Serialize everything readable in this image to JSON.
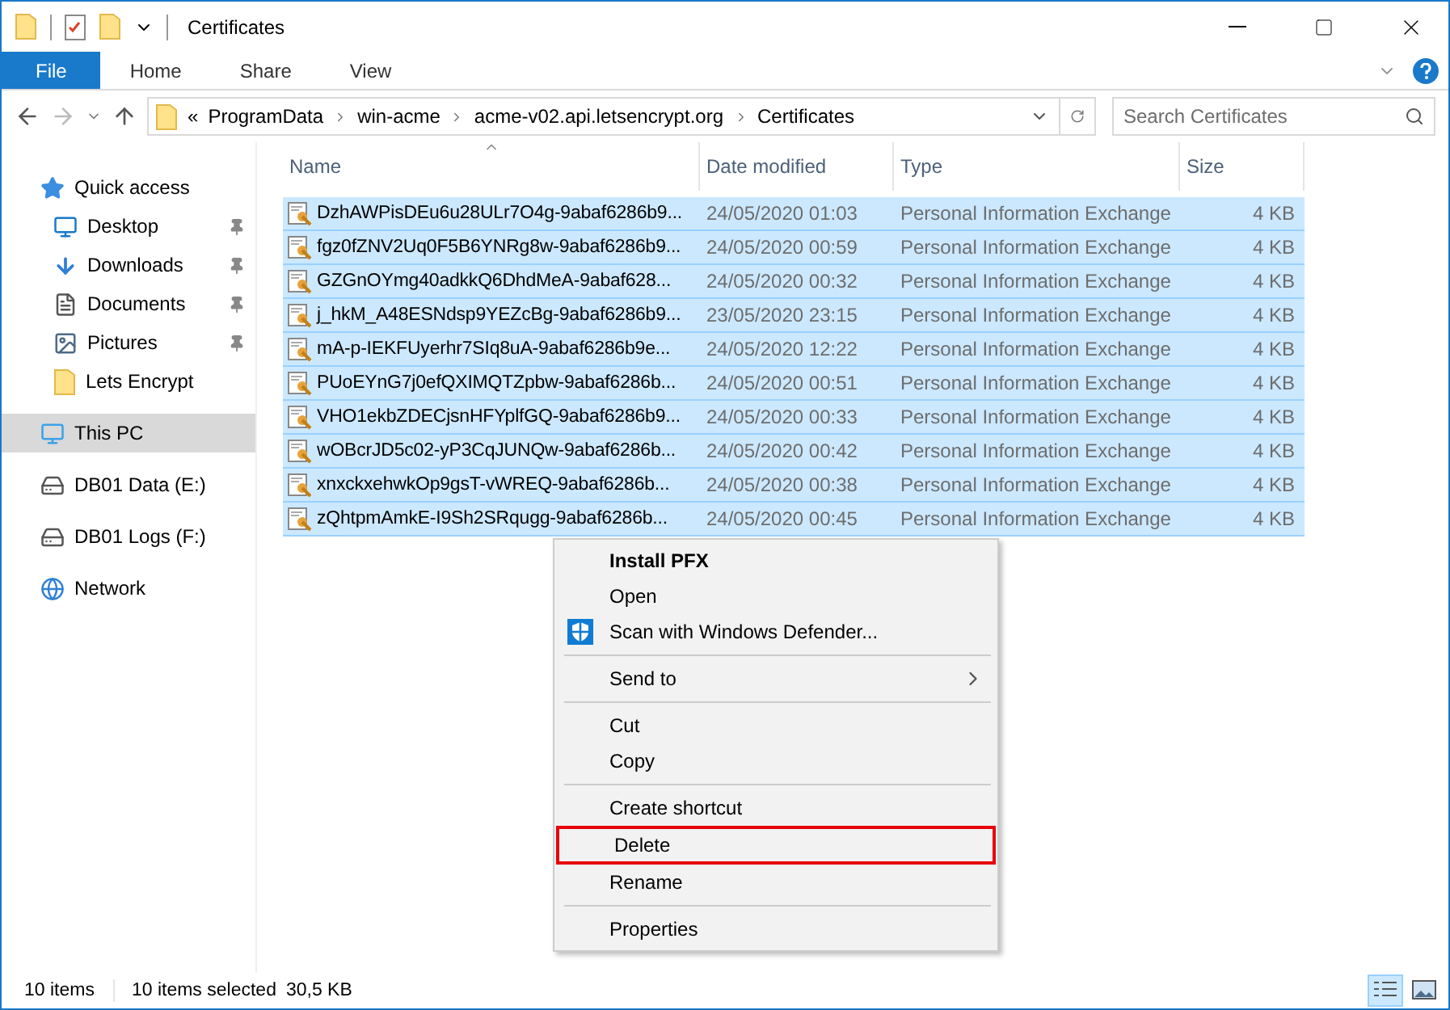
{
  "window": {
    "title": "Certificates"
  },
  "ribbon": {
    "tabs": [
      {
        "label": "File",
        "kind": "file",
        "selected": true
      },
      {
        "label": "Home",
        "kind": "tab",
        "selected": false
      },
      {
        "label": "Share",
        "kind": "tab",
        "selected": false
      },
      {
        "label": "View",
        "kind": "tab",
        "selected": false
      }
    ]
  },
  "address": {
    "overflow": "«",
    "crumbs": [
      "ProgramData",
      "win-acme",
      "acme-v02.api.letsencrypt.org",
      "Certificates"
    ]
  },
  "search": {
    "placeholder": "Search Certificates"
  },
  "sidebar": {
    "items": [
      {
        "label": "Quick access",
        "kind": "star",
        "selected": false,
        "children": [
          {
            "label": "Desktop",
            "kind": "desktop",
            "pinned": true,
            "selected": false
          },
          {
            "label": "Downloads",
            "kind": "download",
            "pinned": true,
            "selected": false
          },
          {
            "label": "Documents",
            "kind": "document",
            "pinned": true,
            "selected": false
          },
          {
            "label": "Pictures",
            "kind": "pictures",
            "pinned": true,
            "selected": false
          },
          {
            "label": "Lets Encrypt",
            "kind": "folder",
            "pinned": false,
            "selected": false
          }
        ]
      },
      {
        "label": "This PC",
        "kind": "pc",
        "selected": true
      },
      {
        "label": "DB01 Data (E:)",
        "kind": "drive",
        "selected": false
      },
      {
        "label": "DB01 Logs (F:)",
        "kind": "drive",
        "selected": false
      },
      {
        "label": "Network",
        "kind": "network",
        "selected": false
      }
    ]
  },
  "table": {
    "columns": [
      {
        "label": "Name",
        "sorted": true
      },
      {
        "label": "Date modified",
        "sorted": false
      },
      {
        "label": "Type",
        "sorted": false
      },
      {
        "label": "Size",
        "sorted": false
      }
    ],
    "rows": [
      {
        "name": "DzhAWPisDEu6u28ULr7O4g-9abaf6286b9...",
        "date": "24/05/2020 01:03",
        "type": "Personal Information Exchange",
        "size": "4 KB",
        "selected": true
      },
      {
        "name": "fgz0fZNV2Uq0F5B6YNRg8w-9abaf6286b9...",
        "date": "24/05/2020 00:59",
        "type": "Personal Information Exchange",
        "size": "4 KB",
        "selected": true
      },
      {
        "name": "GZGnOYmg40adkkQ6DhdMeA-9abaf628...",
        "date": "24/05/2020 00:32",
        "type": "Personal Information Exchange",
        "size": "4 KB",
        "selected": true
      },
      {
        "name": "j_hkM_A48ESNdsp9YEZcBg-9abaf6286b9...",
        "date": "23/05/2020 23:15",
        "type": "Personal Information Exchange",
        "size": "4 KB",
        "selected": true
      },
      {
        "name": "mA-p-IEKFUyerhr7SIq8uA-9abaf6286b9e...",
        "date": "24/05/2020 12:22",
        "type": "Personal Information Exchange",
        "size": "4 KB",
        "selected": true
      },
      {
        "name": "PUoEYnG7j0efQXIMQTZpbw-9abaf6286b...",
        "date": "24/05/2020 00:51",
        "type": "Personal Information Exchange",
        "size": "4 KB",
        "selected": true
      },
      {
        "name": "VHO1ekbZDECjsnHFYplfGQ-9abaf6286b9...",
        "date": "24/05/2020 00:33",
        "type": "Personal Information Exchange",
        "size": "4 KB",
        "selected": true
      },
      {
        "name": "wOBcrJD5c02-yP3CqJUNQw-9abaf6286b...",
        "date": "24/05/2020 00:42",
        "type": "Personal Information Exchange",
        "size": "4 KB",
        "selected": true
      },
      {
        "name": "xnxckxehwkOp9gsT-vWREQ-9abaf6286b...",
        "date": "24/05/2020 00:38",
        "type": "Personal Information Exchange",
        "size": "4 KB",
        "selected": true
      },
      {
        "name": "zQhtpmAmkE-I9Sh2SRqugg-9abaf6286b...",
        "date": "24/05/2020 00:45",
        "type": "Personal Information Exchange",
        "size": "4 KB",
        "selected": true
      }
    ]
  },
  "context_menu": {
    "items": [
      {
        "kind": "item",
        "label": "Install PFX",
        "default": true,
        "has_icon": false,
        "submenu": false,
        "highlighted": false
      },
      {
        "kind": "item",
        "label": "Open",
        "default": false,
        "has_icon": false,
        "submenu": false,
        "highlighted": false
      },
      {
        "kind": "item",
        "label": "Scan with Windows Defender...",
        "default": false,
        "has_icon": true,
        "submenu": false,
        "highlighted": false
      },
      {
        "kind": "separator"
      },
      {
        "kind": "item",
        "label": "Send to",
        "default": false,
        "has_icon": false,
        "submenu": true,
        "highlighted": false
      },
      {
        "kind": "separator"
      },
      {
        "kind": "item",
        "label": "Cut",
        "default": false,
        "has_icon": false,
        "submenu": false,
        "highlighted": false
      },
      {
        "kind": "item",
        "label": "Copy",
        "default": false,
        "has_icon": false,
        "submenu": false,
        "highlighted": false
      },
      {
        "kind": "separator"
      },
      {
        "kind": "item",
        "label": "Create shortcut",
        "default": false,
        "has_icon": false,
        "submenu": false,
        "highlighted": false
      },
      {
        "kind": "item",
        "label": "Delete",
        "default": false,
        "has_icon": false,
        "submenu": false,
        "highlighted": true
      },
      {
        "kind": "item",
        "label": "Rename",
        "default": false,
        "has_icon": false,
        "submenu": false,
        "highlighted": false
      },
      {
        "kind": "separator"
      },
      {
        "kind": "item",
        "label": "Properties",
        "default": false,
        "has_icon": false,
        "submenu": false,
        "highlighted": false
      }
    ]
  },
  "status_bar": {
    "item_count": "10 items",
    "selection": "10 items selected",
    "selection_size": "30,5 KB",
    "views": [
      {
        "kind": "details",
        "selected": true
      },
      {
        "kind": "large-icons",
        "selected": false
      }
    ]
  }
}
